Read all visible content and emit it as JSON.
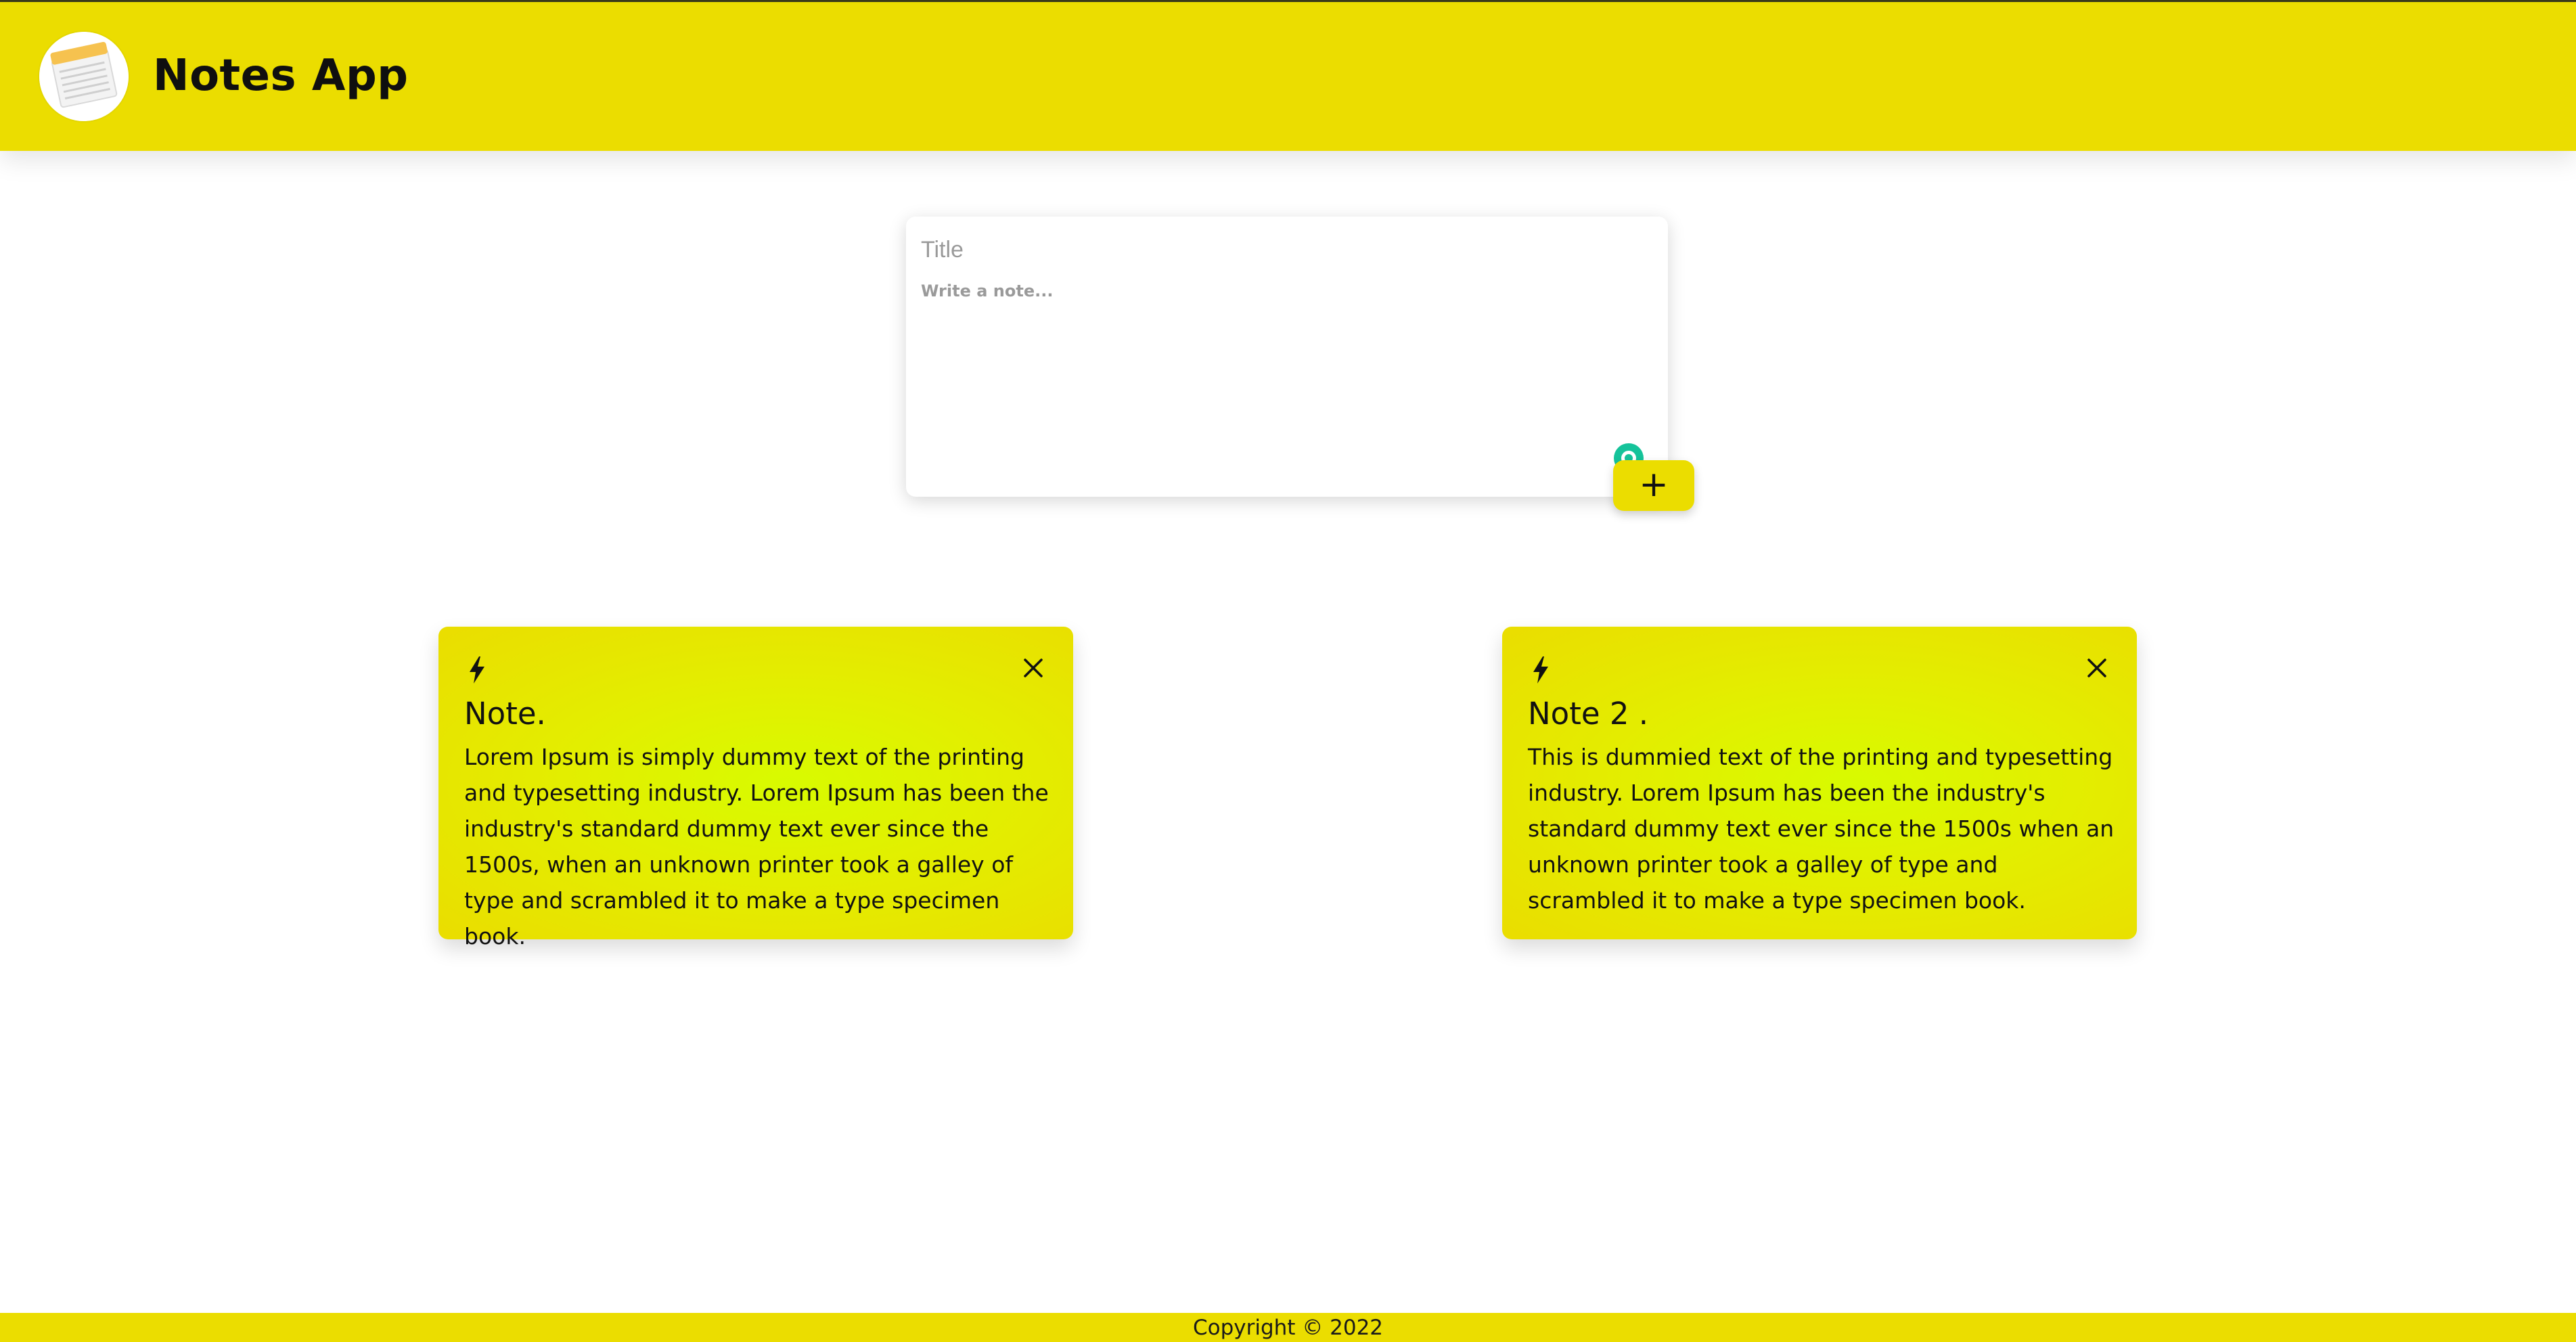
{
  "header": {
    "app_title": "Notes App",
    "logo_icon": "notepad-icon"
  },
  "create_area": {
    "title_placeholder": "Title",
    "note_placeholder": "Write a note...",
    "add_label": "+"
  },
  "notes": [
    {
      "title": "Note.",
      "body": "Lorem Ipsum is simply dummy text of the printing and typesetting industry. Lorem Ipsum has been the industry's standard dummy text ever since the 1500s, when an unknown printer took a galley of type and scrambled it to make a type specimen book.",
      "icon": "lightning-bolt-icon",
      "close_icon": "close-icon"
    },
    {
      "title": "Note 2 .",
      "body": "This is dummied text of the printing and typesetting industry. Lorem Ipsum has been the industry's standard dummy text ever since the 1500s when an unknown printer took a galley of type and scrambled it to make a type specimen book.",
      "icon": "lightning-bolt-icon",
      "close_icon": "close-icon"
    }
  ],
  "footer": {
    "copyright": "Copyright © 2022"
  },
  "colors": {
    "brand_yellow": "#ebdd00",
    "note_highlight": "#d8fb00",
    "grammarly_green": "#15c39a"
  }
}
